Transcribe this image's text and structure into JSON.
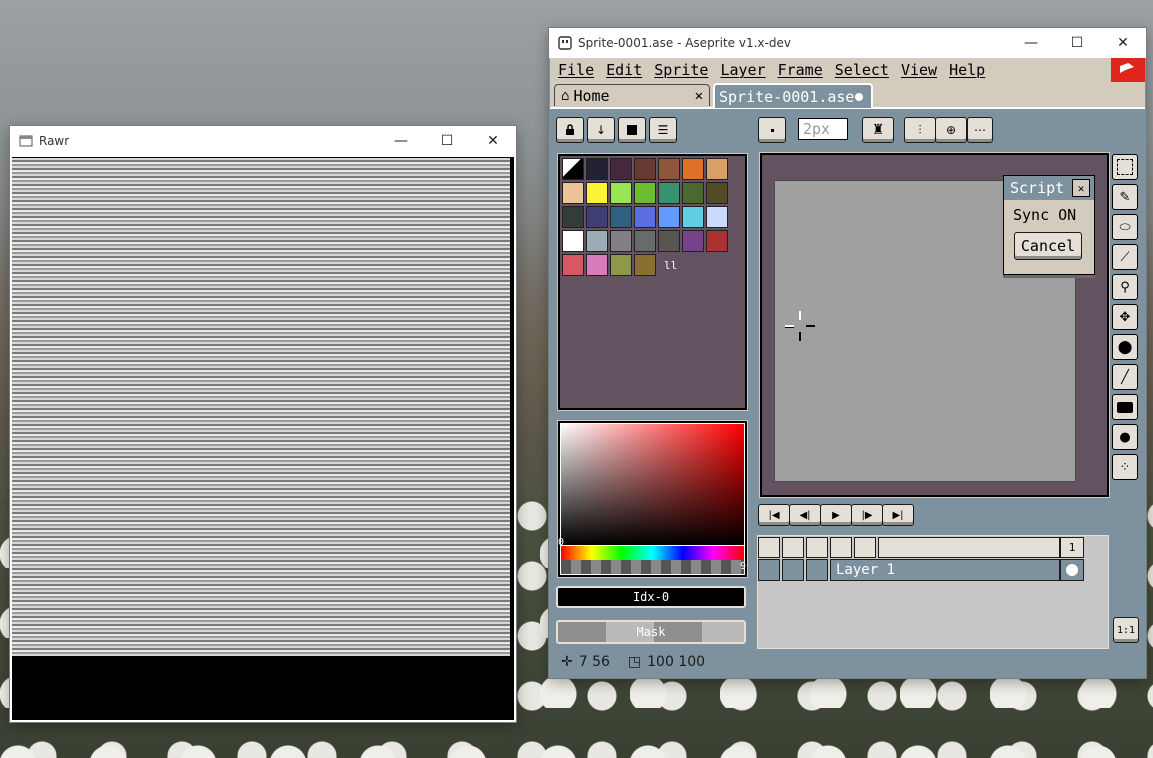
{
  "rawr_window": {
    "title": "Rawr",
    "controls": {
      "minimize": "—",
      "maximize": "☐",
      "close": "✕"
    }
  },
  "aseprite_window": {
    "title": "Sprite-0001.ase - Aseprite v1.x-dev",
    "controls": {
      "minimize": "—",
      "maximize": "☐",
      "close": "✕"
    },
    "menu": [
      "File",
      "Edit",
      "Sprite",
      "Layer",
      "Frame",
      "Select",
      "View",
      "Help"
    ],
    "tabs": [
      {
        "label": "Home",
        "icon": "home-icon"
      },
      {
        "label": "Sprite-0001.ase",
        "icon": "unsaved-dot-icon"
      }
    ],
    "brush_size": "2px",
    "palette": {
      "colors": [
        "#000000",
        "#222034",
        "#45283c",
        "#663931",
        "#8f563b",
        "#df7126",
        "#d9a066",
        "#eec39a",
        "#fbf236",
        "#99e550",
        "#6abe30",
        "#37946e",
        "#4b692f",
        "#524b24",
        "#323c39",
        "#3f3f74",
        "#306082",
        "#5b6ee1",
        "#639bff",
        "#5fcde4",
        "#cbdbfc",
        "#ffffff",
        "#9badb7",
        "#847e87",
        "#696a6a",
        "#595652",
        "#76428a",
        "#ac3232",
        "#d95763",
        "#d77bba",
        "#8f974a",
        "#8a6f30"
      ]
    },
    "color_bar": {
      "index_label": "Idx-0",
      "mask_label": "Mask"
    },
    "color_picker": {
      "hue_min": "0",
      "hue_max": "9"
    },
    "script_dialog": {
      "title": "Script",
      "status": "Sync ON",
      "cancel_label": "Cancel"
    },
    "timeline": {
      "frame_number": "1",
      "layer_name": "Layer 1"
    },
    "zoom_label": "1:1",
    "status_bar": {
      "cursor_pos": "7 56",
      "sprite_size": "100 100"
    },
    "colors": {
      "panel_bg": "#7d929e",
      "menu_bg": "#d3cbbe",
      "canvas_bg": "#a0a0a0",
      "accent": "#e0251c"
    }
  }
}
